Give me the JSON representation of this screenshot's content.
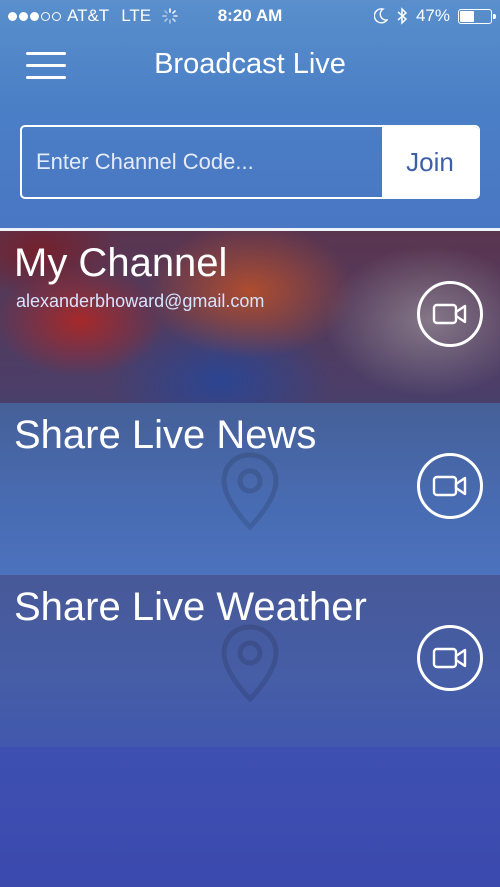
{
  "status_bar": {
    "carrier": "AT&T",
    "network": "LTE",
    "time": "8:20 AM",
    "battery": "47%",
    "battery_level": 0.47,
    "signal_bars_filled": 3,
    "signal_bars_total": 5
  },
  "nav": {
    "title": "Broadcast Live",
    "menu_icon": "hamburger-menu-icon"
  },
  "join": {
    "placeholder": "Enter Channel Code...",
    "value": "",
    "button_label": "Join"
  },
  "channels": [
    {
      "title": "My Channel",
      "subtitle": "alexanderbhoward@gmail.com",
      "icon": "video-camera-icon"
    },
    {
      "title": "Share Live News",
      "icon": "video-camera-icon"
    },
    {
      "title": "Share Live Weather",
      "icon": "video-camera-icon"
    }
  ],
  "colors": {
    "background_top": "#5a8fcc",
    "background_bottom": "#3b49ad",
    "join_button_text": "#3d5fa8",
    "subtitle": "#d6e4ff"
  }
}
